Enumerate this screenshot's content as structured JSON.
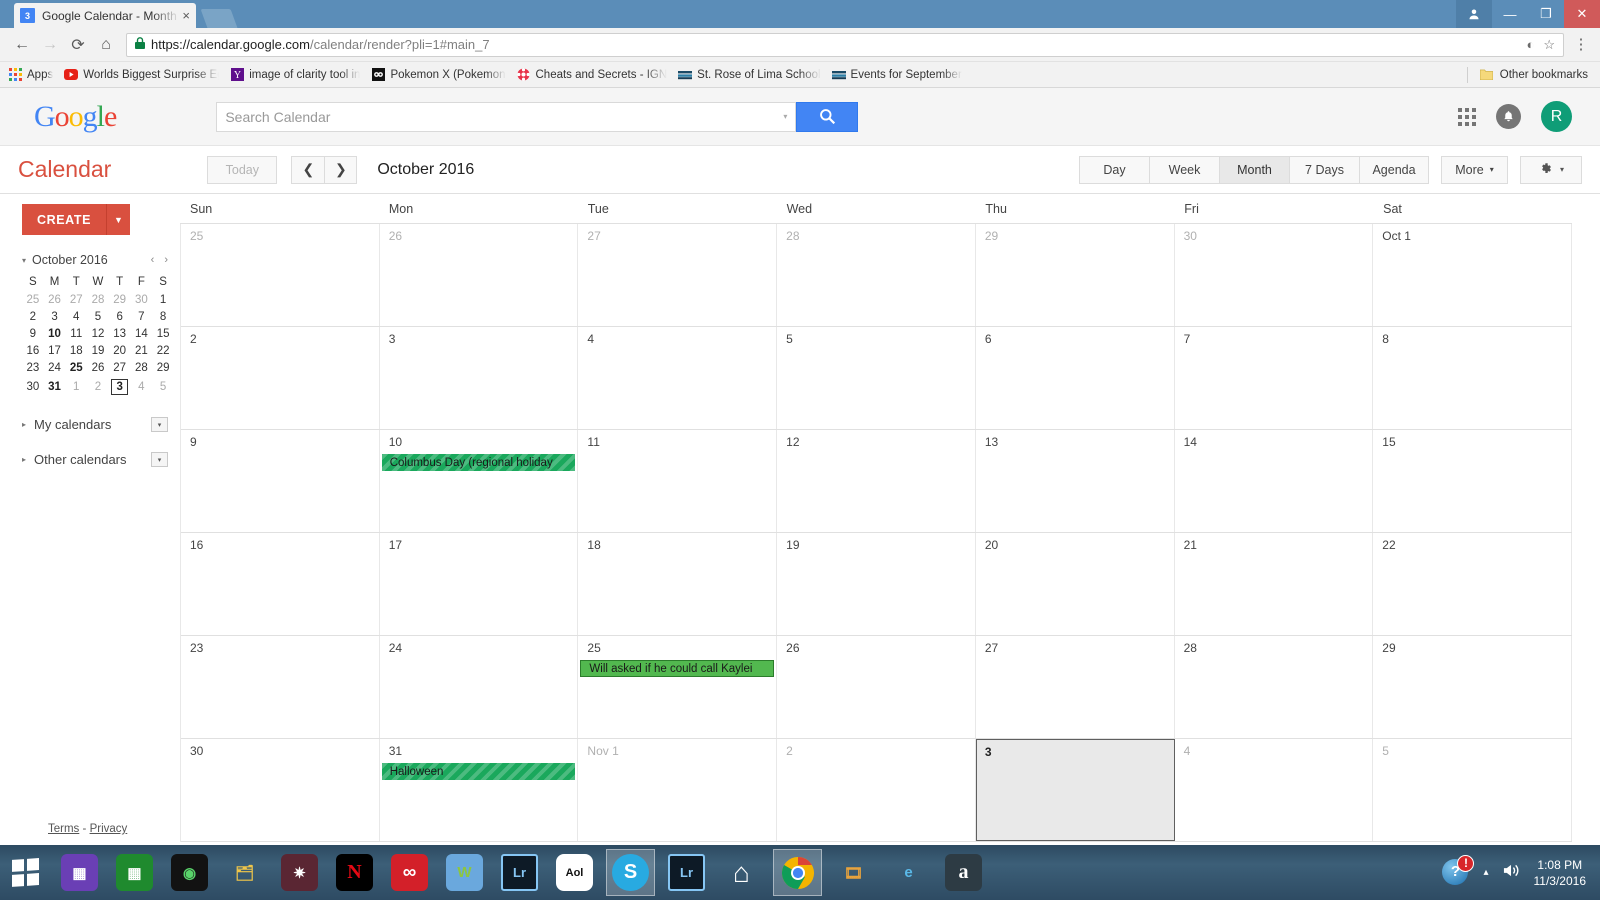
{
  "browser": {
    "tab": {
      "favicon_text": "3",
      "title": "Google Calendar - Month",
      "close_icon": "×"
    },
    "nav": {
      "back": "←",
      "forward": "→",
      "reload": "⟳",
      "home": "⌂"
    },
    "omnibox": {
      "lock_icon": "🔒",
      "url_host": "https://calendar.google.com",
      "url_rest": "/calendar/render?pli=1#main_7",
      "save_icon": "◐",
      "star_icon": "☆",
      "menu_icon": "⋮"
    },
    "bookmarks": [
      {
        "label": "Apps",
        "icon": "apps-grid-icon"
      },
      {
        "label": "Worlds Biggest Surprise Egg",
        "icon": "youtube-icon"
      },
      {
        "label": "image of clarity tool in",
        "icon": "yahoo-icon"
      },
      {
        "label": "Pokemon X (Pokemon",
        "icon": "pokemon-icon"
      },
      {
        "label": "Cheats and Secrets - IGN",
        "icon": "ign-icon"
      },
      {
        "label": "St. Rose of Lima School",
        "icon": "school-icon"
      },
      {
        "label": "Events for September",
        "icon": "school-icon"
      }
    ],
    "other_bookmarks": "Other bookmarks",
    "window_controls": {
      "person": "👤",
      "minimize": "—",
      "maximize": "❐",
      "close": "✕"
    }
  },
  "google_header": {
    "logo": "Google",
    "search": {
      "placeholder": "Search Calendar",
      "value": "",
      "caret": "▾",
      "button_icon": "search-icon"
    },
    "apps_icon": "apps-grid-icon",
    "notifications_icon": "bell-icon",
    "avatar_letter": "R"
  },
  "cal_toolbar": {
    "brand": "Calendar",
    "today": "Today",
    "prev": "❮",
    "next": "❯",
    "period": "October 2016",
    "views": [
      "Day",
      "Week",
      "Month",
      "7 Days",
      "Agenda"
    ],
    "active_view": "Month",
    "more": "More",
    "more_caret": "▾",
    "gear_icon": "gear-icon",
    "gear_caret": "▾"
  },
  "sidebar": {
    "create": "CREATE",
    "create_caret": "▼",
    "mini_title": "October 2016",
    "mini_tri": "▾",
    "mini_prev": "‹",
    "mini_next": "›",
    "mini_dow": [
      "S",
      "M",
      "T",
      "W",
      "T",
      "F",
      "S"
    ],
    "mini_weeks": [
      [
        {
          "d": "25",
          "t": "other"
        },
        {
          "d": "26",
          "t": "other"
        },
        {
          "d": "27",
          "t": "other"
        },
        {
          "d": "28",
          "t": "other"
        },
        {
          "d": "29",
          "t": "other"
        },
        {
          "d": "30",
          "t": "other"
        },
        {
          "d": "1",
          "t": "cur"
        }
      ],
      [
        {
          "d": "2",
          "t": "cur"
        },
        {
          "d": "3",
          "t": "cur"
        },
        {
          "d": "4",
          "t": "cur"
        },
        {
          "d": "5",
          "t": "cur"
        },
        {
          "d": "6",
          "t": "cur"
        },
        {
          "d": "7",
          "t": "cur"
        },
        {
          "d": "8",
          "t": "cur"
        }
      ],
      [
        {
          "d": "9",
          "t": "cur"
        },
        {
          "d": "10",
          "t": "bold"
        },
        {
          "d": "11",
          "t": "cur"
        },
        {
          "d": "12",
          "t": "cur"
        },
        {
          "d": "13",
          "t": "cur"
        },
        {
          "d": "14",
          "t": "cur"
        },
        {
          "d": "15",
          "t": "cur"
        }
      ],
      [
        {
          "d": "16",
          "t": "cur"
        },
        {
          "d": "17",
          "t": "cur"
        },
        {
          "d": "18",
          "t": "cur"
        },
        {
          "d": "19",
          "t": "cur"
        },
        {
          "d": "20",
          "t": "cur"
        },
        {
          "d": "21",
          "t": "cur"
        },
        {
          "d": "22",
          "t": "cur"
        }
      ],
      [
        {
          "d": "23",
          "t": "cur"
        },
        {
          "d": "24",
          "t": "cur"
        },
        {
          "d": "25",
          "t": "bold"
        },
        {
          "d": "26",
          "t": "cur"
        },
        {
          "d": "27",
          "t": "cur"
        },
        {
          "d": "28",
          "t": "cur"
        },
        {
          "d": "29",
          "t": "cur"
        }
      ],
      [
        {
          "d": "30",
          "t": "cur"
        },
        {
          "d": "31",
          "t": "bold"
        },
        {
          "d": "1",
          "t": "other"
        },
        {
          "d": "2",
          "t": "other"
        },
        {
          "d": "3",
          "t": "today"
        },
        {
          "d": "4",
          "t": "other"
        },
        {
          "d": "5",
          "t": "other"
        }
      ]
    ],
    "groups": [
      {
        "label": "My calendars",
        "tri": "▸",
        "drop": "▾"
      },
      {
        "label": "Other calendars",
        "tri": "▸",
        "drop": "▾"
      }
    ],
    "footer": {
      "terms": "Terms",
      "sep": "-",
      "privacy": "Privacy"
    }
  },
  "grid": {
    "dow": [
      "Sun",
      "Mon",
      "Tue",
      "Wed",
      "Thu",
      "Fri",
      "Sat"
    ],
    "weeks": [
      [
        {
          "num": "25",
          "kind": "other",
          "events": []
        },
        {
          "num": "26",
          "kind": "other",
          "events": []
        },
        {
          "num": "27",
          "kind": "other",
          "events": []
        },
        {
          "num": "28",
          "kind": "other",
          "events": []
        },
        {
          "num": "29",
          "kind": "other",
          "events": []
        },
        {
          "num": "30",
          "kind": "other",
          "events": []
        },
        {
          "num": "Oct 1",
          "kind": "cur",
          "events": []
        }
      ],
      [
        {
          "num": "2",
          "kind": "cur",
          "events": []
        },
        {
          "num": "3",
          "kind": "cur",
          "events": []
        },
        {
          "num": "4",
          "kind": "cur",
          "events": []
        },
        {
          "num": "5",
          "kind": "cur",
          "events": []
        },
        {
          "num": "6",
          "kind": "cur",
          "events": []
        },
        {
          "num": "7",
          "kind": "cur",
          "events": []
        },
        {
          "num": "8",
          "kind": "cur",
          "events": []
        }
      ],
      [
        {
          "num": "9",
          "kind": "cur",
          "events": []
        },
        {
          "num": "10",
          "kind": "cur",
          "events": [
            {
              "title": "Columbus Day (regional holiday",
              "style": "holiday"
            }
          ]
        },
        {
          "num": "11",
          "kind": "cur",
          "events": []
        },
        {
          "num": "12",
          "kind": "cur",
          "events": []
        },
        {
          "num": "13",
          "kind": "cur",
          "events": []
        },
        {
          "num": "14",
          "kind": "cur",
          "events": []
        },
        {
          "num": "15",
          "kind": "cur",
          "events": []
        }
      ],
      [
        {
          "num": "16",
          "kind": "cur",
          "events": []
        },
        {
          "num": "17",
          "kind": "cur",
          "events": []
        },
        {
          "num": "18",
          "kind": "cur",
          "events": []
        },
        {
          "num": "19",
          "kind": "cur",
          "events": []
        },
        {
          "num": "20",
          "kind": "cur",
          "events": []
        },
        {
          "num": "21",
          "kind": "cur",
          "events": []
        },
        {
          "num": "22",
          "kind": "cur",
          "events": []
        }
      ],
      [
        {
          "num": "23",
          "kind": "cur",
          "events": []
        },
        {
          "num": "24",
          "kind": "cur",
          "events": []
        },
        {
          "num": "25",
          "kind": "cur",
          "events": [
            {
              "title": "Will asked if he could call Kaylei",
              "style": "green"
            }
          ]
        },
        {
          "num": "26",
          "kind": "cur",
          "events": []
        },
        {
          "num": "27",
          "kind": "cur",
          "events": []
        },
        {
          "num": "28",
          "kind": "cur",
          "events": []
        },
        {
          "num": "29",
          "kind": "cur",
          "events": []
        }
      ],
      [
        {
          "num": "30",
          "kind": "cur",
          "events": []
        },
        {
          "num": "31",
          "kind": "cur",
          "events": [
            {
              "title": "Halloween",
              "style": "holiday"
            }
          ]
        },
        {
          "num": "Nov 1",
          "kind": "other",
          "events": []
        },
        {
          "num": "2",
          "kind": "other",
          "events": []
        },
        {
          "num": "3",
          "kind": "today",
          "events": []
        },
        {
          "num": "4",
          "kind": "other",
          "events": []
        },
        {
          "num": "5",
          "kind": "other",
          "events": []
        }
      ]
    ],
    "colors": {
      "holiday_green": "#1aa85c",
      "event_green": "#52b84f",
      "event_border": "#2b7c2b"
    }
  },
  "taskbar": {
    "start_icon": "windows-logo-icon",
    "items": [
      {
        "name": "calendar-app-icon",
        "glyph": "▦",
        "bg": "#6a3fb5",
        "color": "#ffffff",
        "running": false
      },
      {
        "name": "calculator-icon",
        "glyph": "▦",
        "bg": "#1f8a2e",
        "color": "#ffffff",
        "running": false
      },
      {
        "name": "media-player-icon",
        "glyph": "◉",
        "bg": "#121212",
        "color": "#59d36a",
        "running": false
      },
      {
        "name": "file-explorer-icon",
        "glyph": "🗂",
        "bg": "transparent",
        "color": "#f0c64a",
        "running": false
      },
      {
        "name": "puzzle-game-icon",
        "glyph": "✷",
        "bg": "#5a2633",
        "color": "#ffffff",
        "running": false
      },
      {
        "name": "netflix-icon",
        "glyph": "N",
        "bg": "#000000",
        "color": "#e50914",
        "running": false
      },
      {
        "name": "creative-cloud-icon",
        "glyph": "∞",
        "bg": "#d32029",
        "color": "#ffffff",
        "running": false
      },
      {
        "name": "wondershare-icon",
        "glyph": "W",
        "bg": "#6aa8dd",
        "color": "#8dc63f",
        "running": false
      },
      {
        "name": "lightroom-icon",
        "glyph": "Lr",
        "bg": "#0d1a26",
        "color": "#86c6f4",
        "running": false
      },
      {
        "name": "aol-icon",
        "glyph": "Aol",
        "bg": "#ffffff",
        "color": "#111111",
        "running": false
      },
      {
        "name": "skype-icon",
        "glyph": "S",
        "bg": "#28aae1",
        "color": "#ffffff",
        "running": true
      },
      {
        "name": "lightroom-2-icon",
        "glyph": "Lr",
        "bg": "#0d1a26",
        "color": "#86c6f4",
        "running": false
      },
      {
        "name": "home-icon",
        "glyph": "⌂",
        "bg": "transparent",
        "color": "#ffffff",
        "running": false
      },
      {
        "name": "chrome-icon",
        "glyph": "◉",
        "bg": "transparent",
        "color": "#ffffff",
        "running": true
      },
      {
        "name": "video-editor-icon",
        "glyph": "🎞",
        "bg": "transparent",
        "color": "#e8a33d",
        "running": false
      },
      {
        "name": "internet-explorer-icon",
        "glyph": "e",
        "bg": "transparent",
        "color": "#5ab9e8",
        "running": false
      },
      {
        "name": "amazon-icon",
        "glyph": "a",
        "bg": "#2d3b44",
        "color": "#ffffff",
        "running": false
      }
    ],
    "tray": {
      "alert_glyph": "?",
      "alert_badge": "!",
      "chevron": "▴",
      "volume_icon": "🔊",
      "time": "1:08 PM",
      "date": "11/3/2016"
    }
  }
}
